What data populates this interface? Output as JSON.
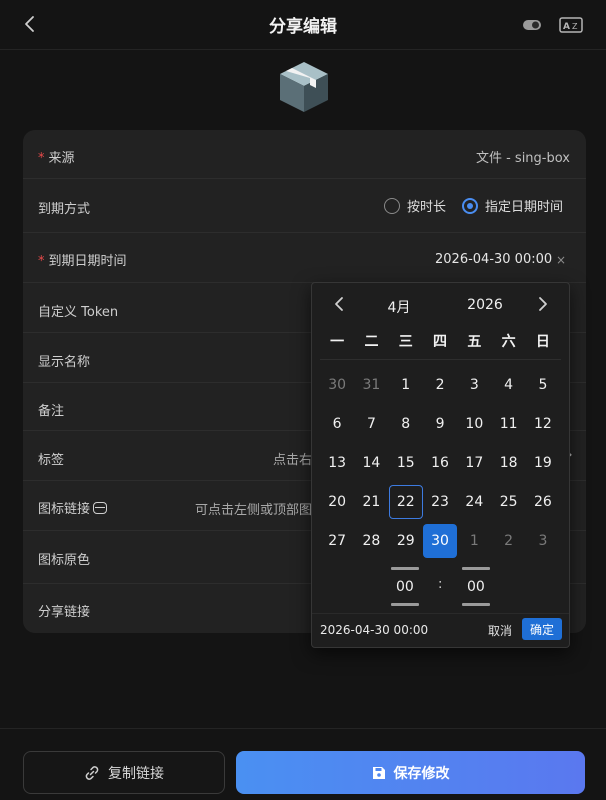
{
  "header": {
    "title": "分享编辑"
  },
  "form": {
    "source": {
      "label": "来源",
      "value": "文件 - sing-box"
    },
    "expire_mode": {
      "label": "到期方式",
      "option_duration": "按时长",
      "option_datetime": "指定日期时间",
      "selected": "指定日期时间"
    },
    "expire_datetime": {
      "label": "到期日期时间",
      "value": "2026-04-30 00:00",
      "clear": "×"
    },
    "custom_token": {
      "label": "自定义 Token"
    },
    "display_name": {
      "label": "显示名称"
    },
    "remark": {
      "label": "备注"
    },
    "tags": {
      "label": "标签",
      "hint": "点击右"
    },
    "icon_link": {
      "label": "图标链接",
      "hint": "可点击左侧或顶部图"
    },
    "icon_original_color": {
      "label": "图标原色"
    },
    "share_link": {
      "label": "分享链接"
    }
  },
  "picker": {
    "month": "4月",
    "year": "2026",
    "weekdays": [
      "一",
      "二",
      "三",
      "四",
      "五",
      "六",
      "日"
    ],
    "days": [
      {
        "d": "30",
        "other": true
      },
      {
        "d": "31",
        "other": true
      },
      {
        "d": "1"
      },
      {
        "d": "2"
      },
      {
        "d": "3"
      },
      {
        "d": "4"
      },
      {
        "d": "5"
      },
      {
        "d": "6"
      },
      {
        "d": "7"
      },
      {
        "d": "8"
      },
      {
        "d": "9"
      },
      {
        "d": "10"
      },
      {
        "d": "11"
      },
      {
        "d": "12"
      },
      {
        "d": "13"
      },
      {
        "d": "14"
      },
      {
        "d": "15"
      },
      {
        "d": "16"
      },
      {
        "d": "17"
      },
      {
        "d": "18"
      },
      {
        "d": "19"
      },
      {
        "d": "20"
      },
      {
        "d": "21"
      },
      {
        "d": "22",
        "today": true
      },
      {
        "d": "23"
      },
      {
        "d": "24"
      },
      {
        "d": "25"
      },
      {
        "d": "26"
      },
      {
        "d": "27"
      },
      {
        "d": "28"
      },
      {
        "d": "29"
      },
      {
        "d": "30",
        "selected": true
      },
      {
        "d": "1",
        "other": true
      },
      {
        "d": "2",
        "other": true
      },
      {
        "d": "3",
        "other": true
      }
    ],
    "hour": "00",
    "minute": "00",
    "colon": ":",
    "current_value": "2026-04-30 00:00",
    "cancel_label": "取消",
    "ok_label": "确定"
  },
  "bottom": {
    "copy_label": "复制链接",
    "save_label": "保存修改"
  },
  "colors": {
    "accent": "#1f6fd6",
    "required": "#e84a4a",
    "save_gradient_start": "#4a90f2",
    "save_gradient_end": "#5a78ef"
  },
  "icons": {
    "back": "chevron-left-icon",
    "toggle": "toggle-icon",
    "az": "az-icon",
    "logo": "box-logo",
    "link": "link-icon",
    "save": "floppy-disk-icon"
  }
}
